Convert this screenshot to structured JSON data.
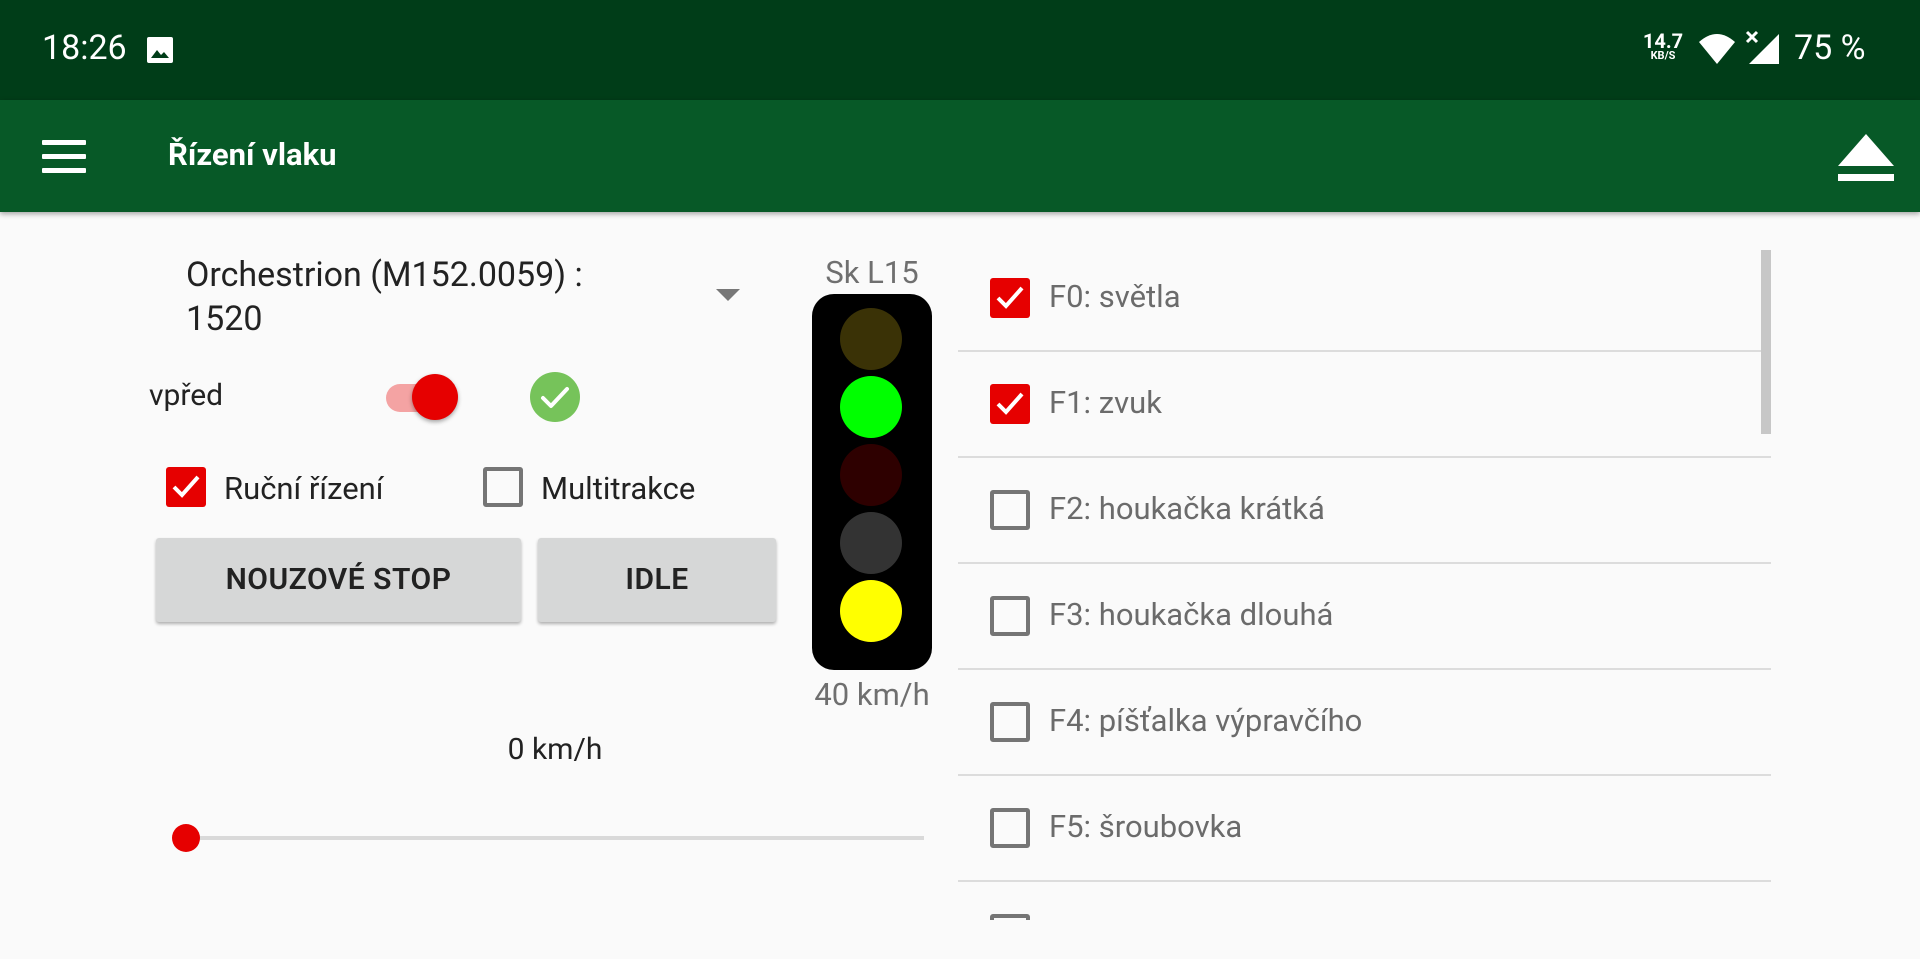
{
  "status_bar": {
    "time": "18:26",
    "net_speed_value": "14.7",
    "net_speed_unit": "KB/S",
    "battery": "75 %",
    "icons": [
      "image-icon",
      "wifi-icon",
      "cell-signal-icon"
    ]
  },
  "app_bar": {
    "title": "Řízení vlaku",
    "left_icon": "hamburger-menu-icon",
    "right_icon": "eject-icon",
    "color": "#075927"
  },
  "control": {
    "locomotive": "Orchestrion (M152.0059) : 1520",
    "direction_label": "vpřed",
    "direction_switch_on": true,
    "status_ok": true,
    "manual_control_label": "Ruční řízení",
    "manual_control_checked": true,
    "multitraction_label": "Multitrakce",
    "multitraction_checked": false,
    "emergency_stop_label": "NOUZOVÉ STOP",
    "idle_label": "IDLE",
    "speed_text": "0 km/h",
    "speed_slider_fraction": 0
  },
  "signal": {
    "name": "Sk L15",
    "speed": "40 km/h",
    "lamps": [
      "#3a3206",
      "#00ff00",
      "#2e0000",
      "#333333",
      "#ffff00"
    ]
  },
  "functions": [
    {
      "label": "F0: světla",
      "checked": true
    },
    {
      "label": "F1: zvuk",
      "checked": true
    },
    {
      "label": "F2: houkačka krátká",
      "checked": false
    },
    {
      "label": "F3: houkačka dlouhá",
      "checked": false
    },
    {
      "label": "F4: píšťalka výpravčího",
      "checked": false
    },
    {
      "label": "F5: šroubovka",
      "checked": false
    }
  ],
  "colors": {
    "accent_red": "#e60000",
    "status_bar": "#003d18",
    "ok_green": "#76c35a"
  }
}
